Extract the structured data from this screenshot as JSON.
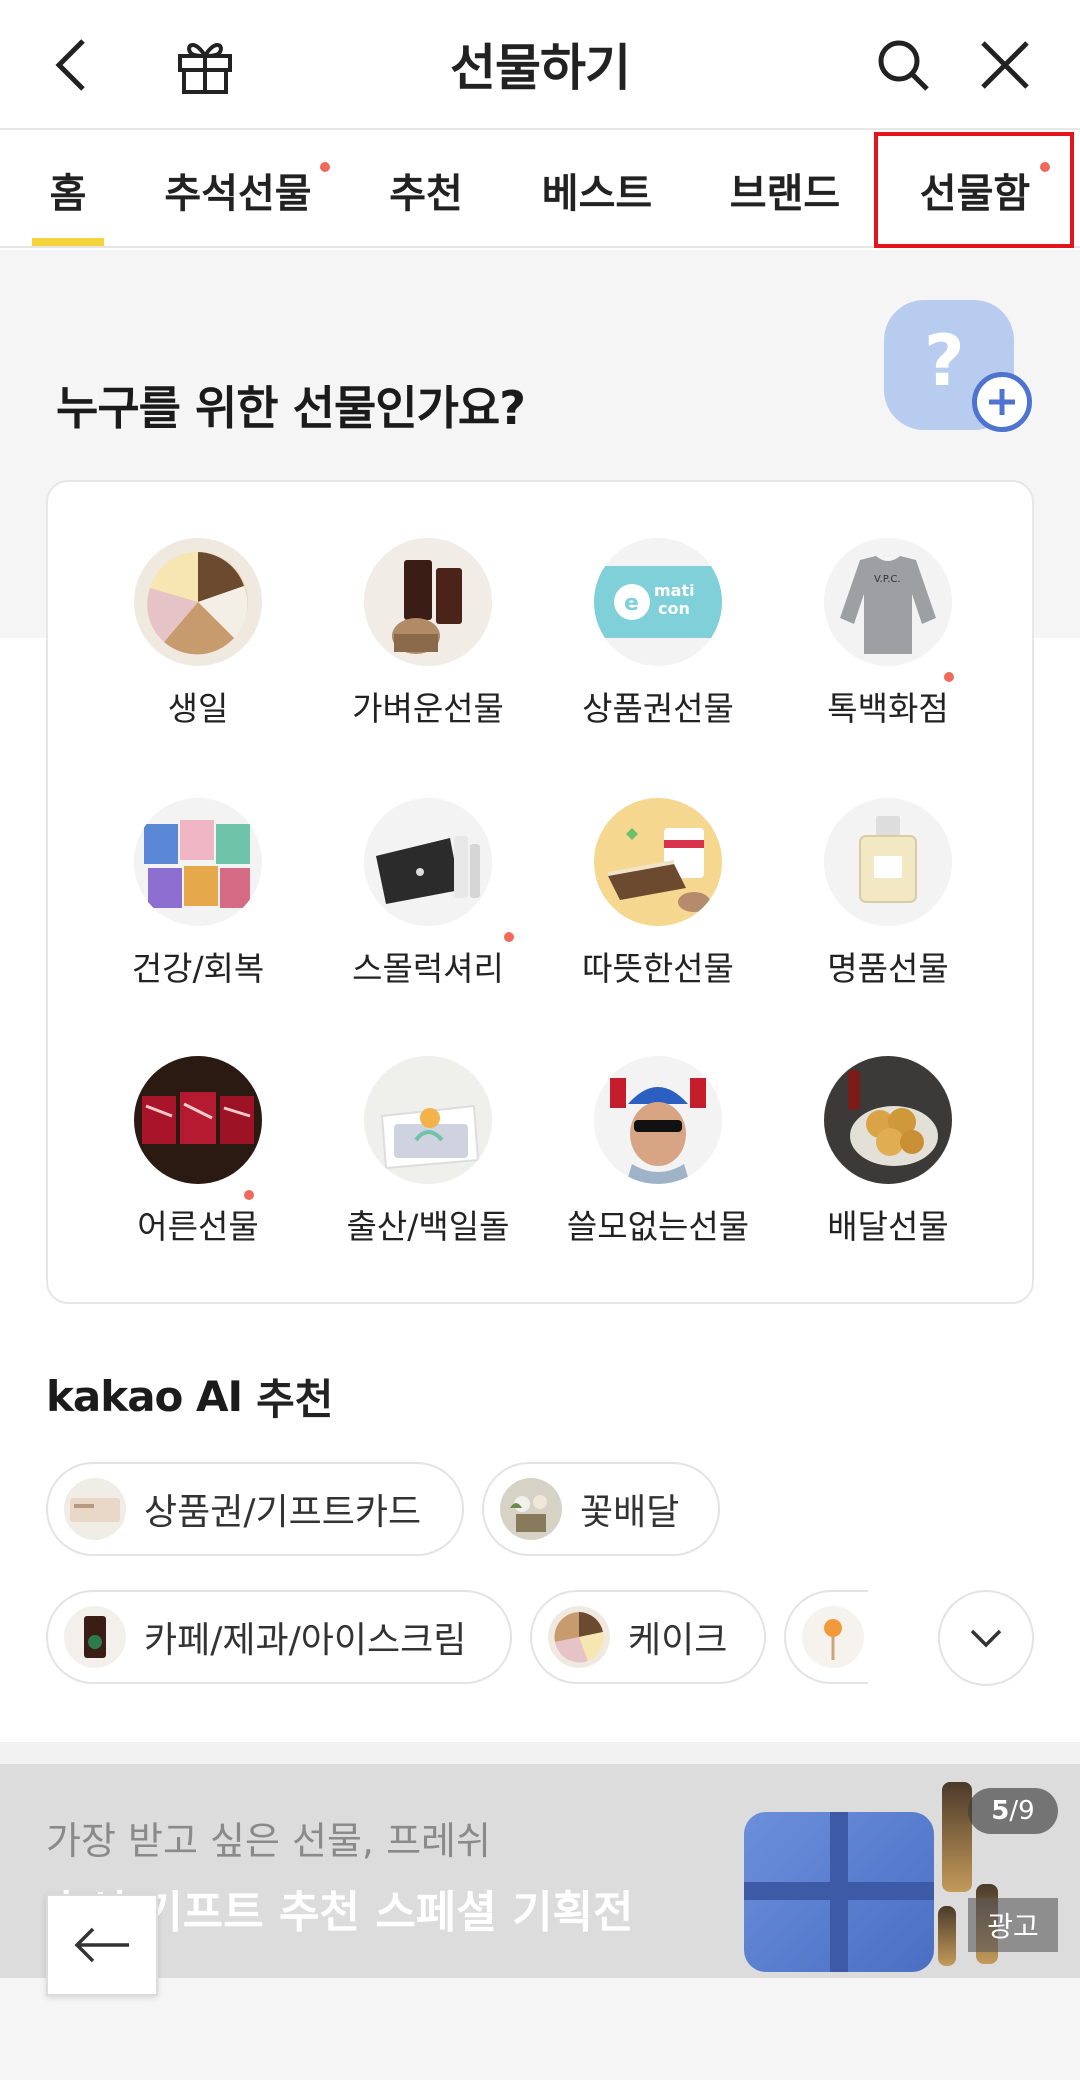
{
  "header": {
    "title": "선물하기"
  },
  "tabs": [
    {
      "label": "홈",
      "active": true,
      "new": false
    },
    {
      "label": "추석선물",
      "active": false,
      "new": true
    },
    {
      "label": "추천",
      "active": false,
      "new": false
    },
    {
      "label": "베스트",
      "active": false,
      "new": false
    },
    {
      "label": "브랜드",
      "active": false,
      "new": false
    },
    {
      "label": "선물함",
      "active": false,
      "new": true
    }
  ],
  "who": {
    "title": "누구를 위한 선물인가요?",
    "avatar_glyph": "?"
  },
  "categories": [
    {
      "label": "생일",
      "new": false
    },
    {
      "label": "가벼운선물",
      "new": false
    },
    {
      "label": "상품권선물",
      "new": false
    },
    {
      "label": "톡백화점",
      "new": true
    },
    {
      "label": "건강/회복",
      "new": false
    },
    {
      "label": "스몰럭셔리",
      "new": true
    },
    {
      "label": "따뜻한선물",
      "new": false
    },
    {
      "label": "명품선물",
      "new": false
    },
    {
      "label": "어른선물",
      "new": true
    },
    {
      "label": "출산/백일돌",
      "new": false
    },
    {
      "label": "쓸모없는선물",
      "new": false
    },
    {
      "label": "배달선물",
      "new": false
    }
  ],
  "ai": {
    "brand": "kakao AI",
    "suffix": "추천",
    "chips": [
      {
        "label": "상품권/기프트카드"
      },
      {
        "label": "꽃배달"
      },
      {
        "label": "카페/제과/아이스크림"
      },
      {
        "label": "케이크"
      },
      {
        "label": ""
      }
    ]
  },
  "banner": {
    "subtitle": "가장 받고 싶은 선물, 프레쉬",
    "title": "추석 기프트 추천 스페셜 기획전",
    "page_current": "5",
    "page_total": "9",
    "ad_label": "광고"
  },
  "colors": {
    "accent": "#f5d33b",
    "new_dot": "#f06a5b",
    "highlight_box": "#e3151a"
  }
}
